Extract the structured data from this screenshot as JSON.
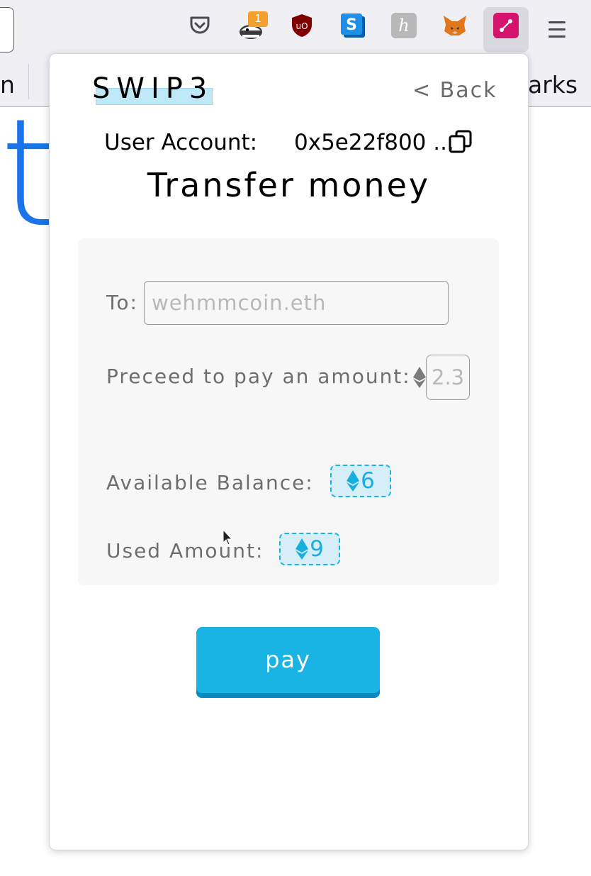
{
  "browser": {
    "bookmarks_left_fragment": "n",
    "bookmarks_right_fragment": "arks",
    "page_fragment": "t",
    "extension_badge_count": "1",
    "extensions": [
      "pocket-icon",
      "privacy-badger-icon",
      "ublock-origin-icon",
      "s-extension-icon",
      "h-extension-icon",
      "metamask-fox-icon",
      "swip3-extension-icon"
    ],
    "menu_icon": "hamburger-menu-icon"
  },
  "popup": {
    "logo": "SWIP3",
    "back_label": "< Back",
    "account_label": "User Account:",
    "account_value": "0x5e22f800 ...",
    "title": "Transfer money",
    "to_label": "To:",
    "to_placeholder": "wehmmcoin.eth",
    "amount_label": "Preceed to pay an amount:",
    "amount_placeholder": "2.3",
    "balance_label": "Available Balance:",
    "balance_value": "6",
    "used_label": "Used Amount:",
    "used_value": "9",
    "pay_label": "pay",
    "currency_icon": "ethereum-icon"
  },
  "colors": {
    "accent": "#19b4e4",
    "accent_dark": "#0a8bbd",
    "chip_bg": "#d6eef8",
    "logo_highlight": "#bfe8f6",
    "link_blue": "#1a73e8"
  }
}
